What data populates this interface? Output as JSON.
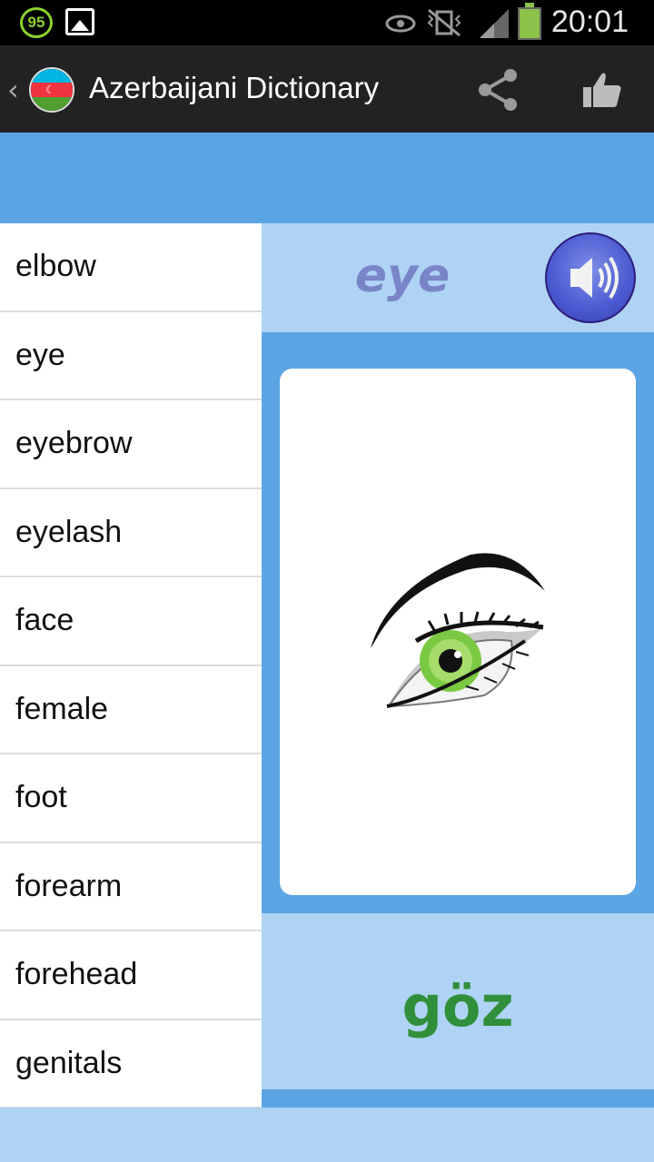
{
  "status_bar": {
    "battery_percent": "95",
    "time": "20:01"
  },
  "action_bar": {
    "title": "Azerbaijani Dictionary",
    "flag_colors": [
      "#00b5e2",
      "#ef3340",
      "#509e2f"
    ]
  },
  "word_list": {
    "items": [
      "elbow",
      "eye",
      "eyebrow",
      "eyelash",
      "face",
      "female",
      "foot",
      "forearm",
      "forehead",
      "genitals"
    ]
  },
  "detail": {
    "english_word": "eye",
    "translation": "göz"
  },
  "colors": {
    "accent_blue": "#5ca5e4",
    "light_blue": "#afd3f4",
    "english_word": "#7a85c8",
    "translation": "#2f8f3a"
  }
}
